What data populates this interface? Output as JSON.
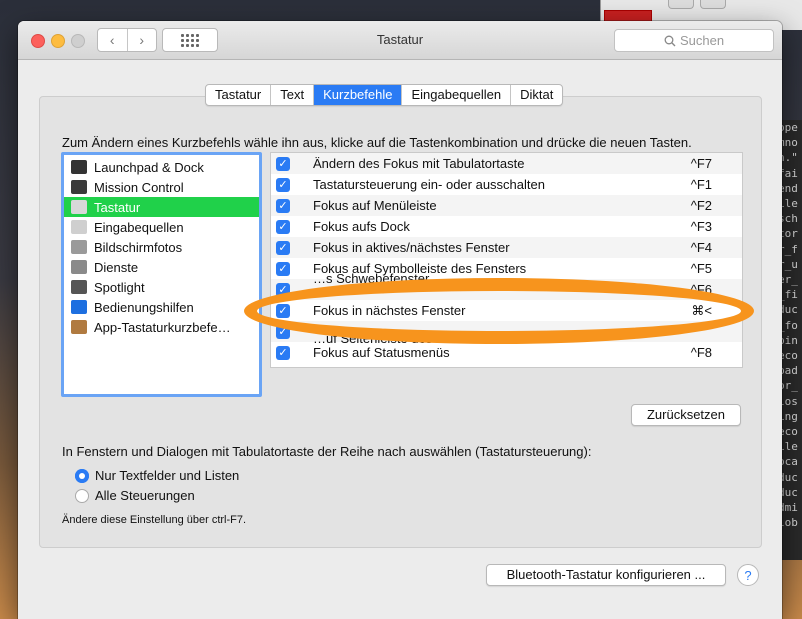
{
  "window": {
    "title": "Tastatur",
    "search_placeholder": "Suchen"
  },
  "tabs": [
    {
      "label": "Tastatur",
      "active": false
    },
    {
      "label": "Text",
      "active": false
    },
    {
      "label": "Kurzbefehle",
      "active": true
    },
    {
      "label": "Eingabequellen",
      "active": false
    },
    {
      "label": "Diktat",
      "active": false
    }
  ],
  "instruction": "Zum Ändern eines Kurzbefehls wähle ihn aus, klicke auf die Tastenkombination und drücke die neuen Tasten.",
  "sidebar": {
    "items": [
      {
        "label": "Launchpad & Dock",
        "icon": "launchpad-icon",
        "color": "#333333",
        "selected": false
      },
      {
        "label": "Mission Control",
        "icon": "mission-control-icon",
        "color": "#3a3a3a",
        "selected": false
      },
      {
        "label": "Tastatur",
        "icon": "keyboard-icon",
        "color": "#d8d8d8",
        "selected": true
      },
      {
        "label": "Eingabequellen",
        "icon": "input-sources-icon",
        "color": "#cfcfcf",
        "selected": false
      },
      {
        "label": "Bildschirmfotos",
        "icon": "screenshot-icon",
        "color": "#9a9a9a",
        "selected": false
      },
      {
        "label": "Dienste",
        "icon": "gear-icon",
        "color": "#8a8a8a",
        "selected": false
      },
      {
        "label": "Spotlight",
        "icon": "spotlight-icon",
        "color": "#555555",
        "selected": false
      },
      {
        "label": "Bedienungshilfen",
        "icon": "accessibility-icon",
        "color": "#1d6fe0",
        "selected": false
      },
      {
        "label": "App-Tastaturkurzbefe…",
        "icon": "app-shortcuts-icon",
        "color": "#b07a40",
        "selected": false
      }
    ]
  },
  "shortcuts": [
    {
      "label": "Ändern des Fokus mit Tabulatortaste",
      "key": "^F7",
      "checked": true
    },
    {
      "label": "Tastatursteuerung ein- oder ausschalten",
      "key": "^F1",
      "checked": true
    },
    {
      "label": "Fokus auf Menüleiste",
      "key": "^F2",
      "checked": true
    },
    {
      "label": "Fokus aufs Dock",
      "key": "^F3",
      "checked": true
    },
    {
      "label": "Fokus in aktives/nächstes Fenster",
      "key": "^F4",
      "checked": true
    },
    {
      "label": "Fokus auf Symbolleiste des Fensters",
      "key": "^F5",
      "checked": true
    },
    {
      "label": "…s Schwebefenster",
      "key": "^F6",
      "checked": true
    },
    {
      "label": "Fokus in nächstes Fenster",
      "key": "⌘<",
      "checked": true
    },
    {
      "label": "…uf Seitenleiste des Fensters",
      "key": "",
      "checked": true
    },
    {
      "label": "Fokus auf Statusmenüs",
      "key": "^F8",
      "checked": true
    }
  ],
  "buttons": {
    "reset": "Zurücksetzen",
    "bluetooth": "Bluetooth-Tastatur konfigurieren ...",
    "help": "?"
  },
  "tab_navigation": {
    "label": "In Fenstern und Dialogen mit Tabulatortaste der Reihe nach auswählen (Tastatursteuerung):",
    "options": [
      {
        "label": "Nur Textfelder und Listen",
        "selected": true
      },
      {
        "label": "Alle Steuerungen",
        "selected": false
      }
    ],
    "hint": "Ändere diese Einstellung über ctrl-F7."
  },
  "terminal_fragments": [
    "ope",
    "",
    "mno",
    "n.\"",
    "fai",
    "end",
    "ile",
    "sch",
    "tor",
    "r_f",
    "r_u",
    "er_",
    "_fi",
    "duc",
    "_fo",
    "pin",
    "eco",
    "bad",
    "or_",
    "los",
    "ing",
    "eco",
    "ile",
    "oca",
    "duc",
    "duc",
    "dmi",
    "lob"
  ],
  "annotation": {
    "color": "#f7941d"
  }
}
